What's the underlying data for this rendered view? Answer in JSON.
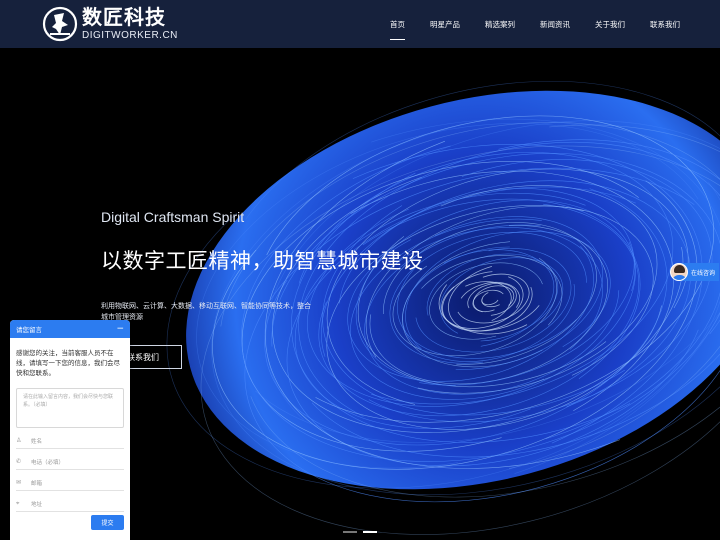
{
  "header": {
    "logo_cn": "数匠科技",
    "logo_en": "DIGITWORKER.CN",
    "nav": [
      {
        "label": "首页",
        "active": true
      },
      {
        "label": "明星产品",
        "active": false
      },
      {
        "label": "精选案列",
        "active": false
      },
      {
        "label": "新闻资讯",
        "active": false
      },
      {
        "label": "关于我们",
        "active": false
      },
      {
        "label": "联系我们",
        "active": false
      }
    ]
  },
  "hero": {
    "tagline_en": "Digital Craftsman Spirit",
    "tagline_cn": "以数字工匠精神，助智慧城市建设",
    "description": "利用物联网、云计算、大数据、移动互联网、智能协同等技术，整合城市管理资源",
    "button_label": "联系我们",
    "slide_count": 2,
    "active_slide": 2
  },
  "float_chat": {
    "label": "在线咨询"
  },
  "message_panel": {
    "title": "请您留言",
    "minimize_icon": "minus-icon",
    "intro": "感谢您的关注，当前客服人员不在线，请填写一下您的信息，我们会尽快和您联系。",
    "textarea_placeholder": "请在此输入留言内容，我们会尽快与您联系。（必填）",
    "fields": [
      {
        "icon": "user-icon",
        "placeholder": "姓名"
      },
      {
        "icon": "phone-icon",
        "placeholder": "电话（必填）"
      },
      {
        "icon": "mail-icon",
        "placeholder": "邮箱"
      },
      {
        "icon": "location-icon",
        "placeholder": "地址"
      }
    ],
    "submit_label": "提交"
  },
  "colors": {
    "accent": "#2c7cf0",
    "header_bg": "#283c6e"
  }
}
